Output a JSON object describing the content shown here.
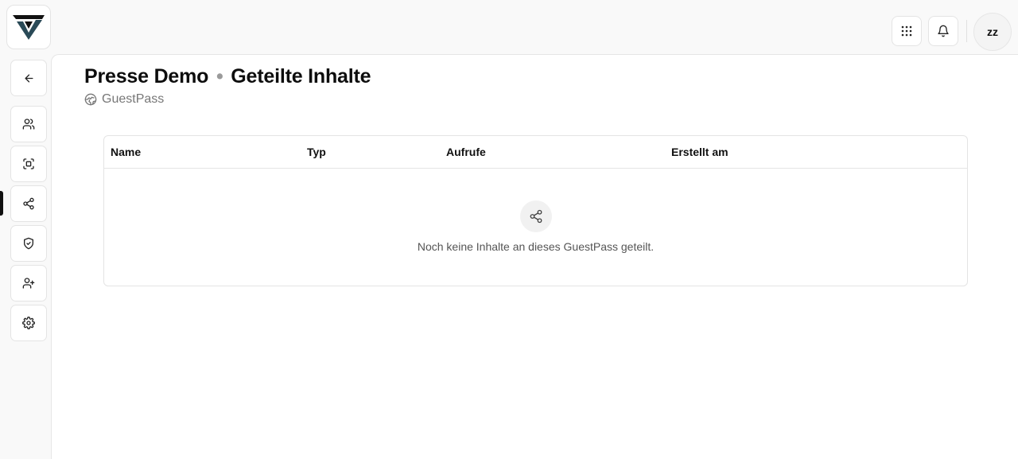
{
  "icons": {
    "logo": "brand-logo",
    "apps": "grid-icon",
    "notifications": "bell-icon",
    "back": "arrow-left-icon",
    "sidebar": [
      "users-icon",
      "scan-face-icon",
      "share-icon",
      "shield-check-icon",
      "user-plus-icon",
      "gear-icon"
    ],
    "subtitle": "globe-icon",
    "empty": "share-icon"
  },
  "header": {
    "avatar_initials": "zz"
  },
  "page": {
    "title_primary": "Presse Demo",
    "title_separator": "•",
    "title_secondary": "Geteilte Inhalte",
    "subtitle": "GuestPass"
  },
  "table": {
    "columns": [
      "Name",
      "Typ",
      "Aufrufe",
      "Erstellt am"
    ],
    "rows": [],
    "empty_message": "Noch keine Inhalte an dieses GuestPass geteilt."
  },
  "colors": {
    "accent": "#111111",
    "logo_teal": "#2a4a57"
  }
}
